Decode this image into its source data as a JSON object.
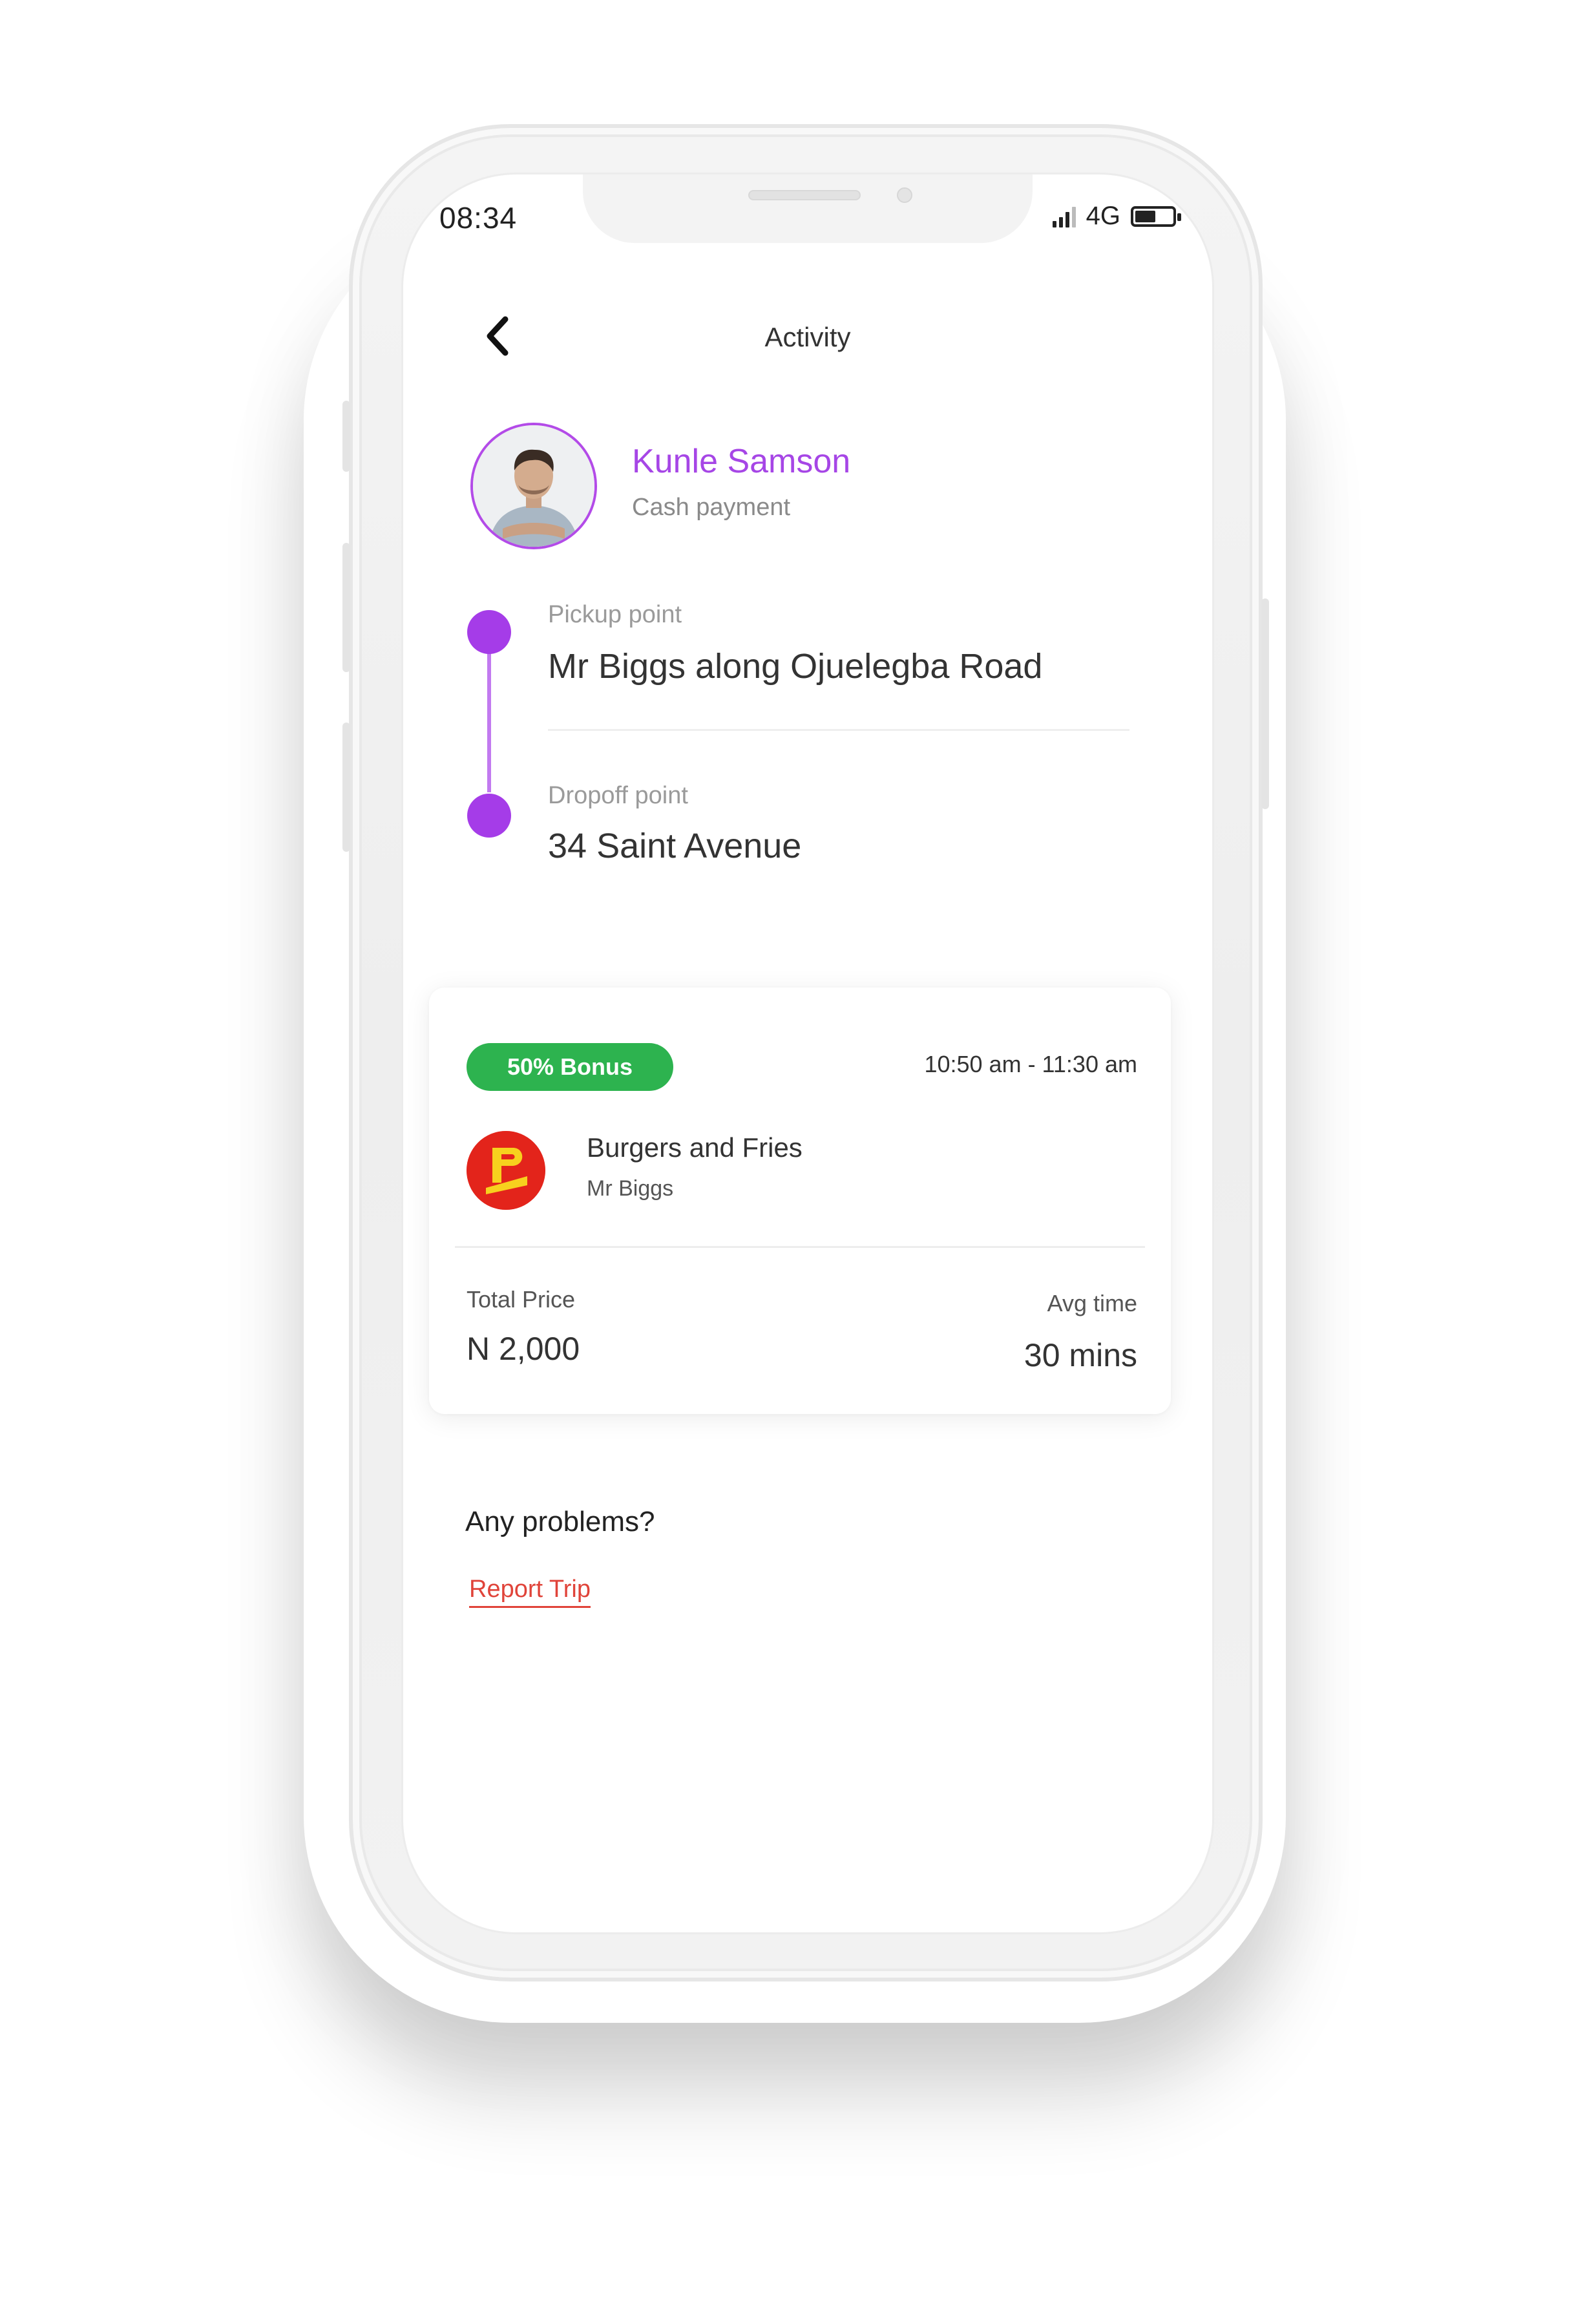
{
  "status_bar": {
    "time": "08:34",
    "network": "4G",
    "battery_level": 0.55
  },
  "header": {
    "title": "Activity",
    "back_icon": "chevron-left-icon"
  },
  "driver": {
    "name": "Kunle Samson",
    "payment": "Cash payment"
  },
  "route": {
    "pickup_label": "Pickup point",
    "pickup_value": "Mr Biggs along Ojuelegba Road",
    "dropoff_label": "Dropoff point",
    "dropoff_value": "34 Saint Avenue"
  },
  "order": {
    "bonus": "50% Bonus",
    "time_range": "10:50 am - 11:30 am",
    "item": "Burgers and Fries",
    "vendor": "Mr Biggs",
    "total_label": "Total Price",
    "total_value": "N 2,000",
    "avg_label": "Avg time",
    "avg_value": "30 mins"
  },
  "support": {
    "question": "Any problems?",
    "report_link": "Report Trip"
  },
  "colors": {
    "accent": "#a646e6",
    "bonus_green": "#2db34f",
    "report_red": "#e0443a",
    "logo_red": "#e3241b",
    "logo_yellow": "#f7d11e"
  }
}
